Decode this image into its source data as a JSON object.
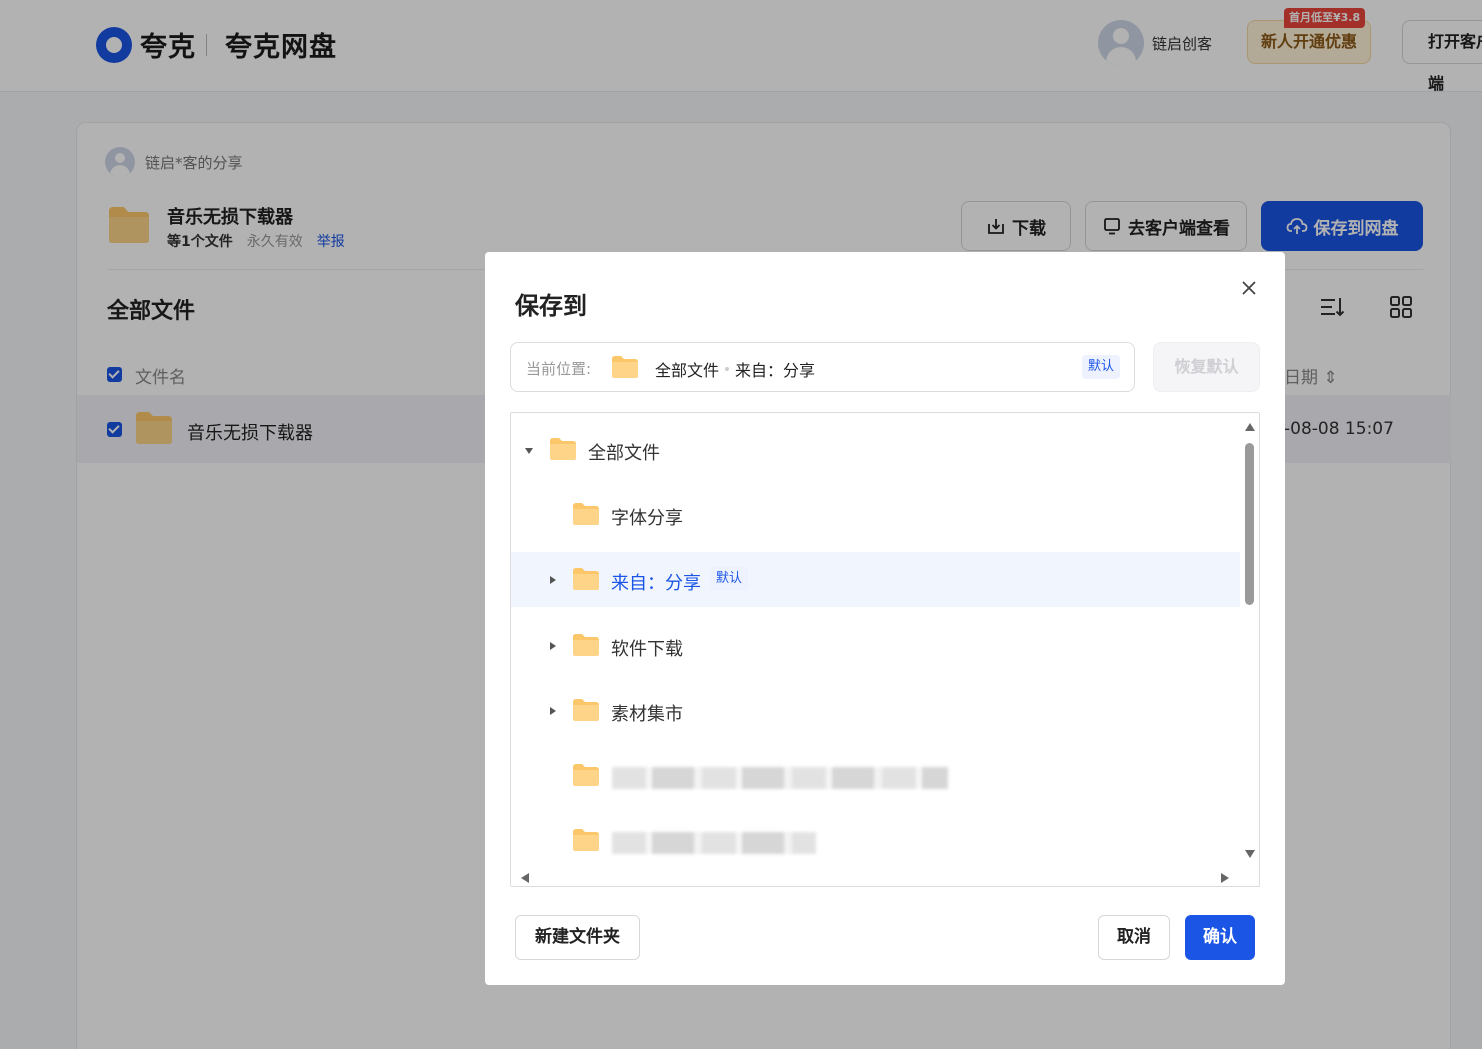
{
  "header": {
    "logo_text_1": "夸克",
    "logo_text_2": "夸克网盘",
    "user_name": "链启创客",
    "promo_badge": "首月低至¥3.8",
    "promo_label": "新人开通优惠",
    "open_client_label": "打开客户端"
  },
  "share": {
    "sharer": "链启*客的分享",
    "title": "音乐无损下载器",
    "count": "等1个文件",
    "validity": "永久有效",
    "report": "举报",
    "download_label": "下载",
    "client_label": "去客户端查看",
    "save_label": "保存到网盘"
  },
  "files": {
    "heading": "全部文件",
    "col_name": "文件名",
    "col_date": "日期",
    "rows": [
      {
        "name": "音乐无损下载器",
        "date": "-08-08 15:07"
      }
    ]
  },
  "modal": {
    "title": "保存到",
    "location_label": "当前位置:",
    "path": [
      "全部文件",
      "来自：分享"
    ],
    "default_tag": "默认",
    "restore_label": "恢复默认",
    "tree": [
      {
        "label": "全部文件",
        "level": 0,
        "expanded": true
      },
      {
        "label": "字体分享",
        "level": 1
      },
      {
        "label": "来自：分享",
        "level": 1,
        "selected": true,
        "default_tag": "默认"
      },
      {
        "label": "软件下载",
        "level": 1
      },
      {
        "label": "素材集市",
        "level": 1
      }
    ],
    "new_folder_label": "新建文件夹",
    "cancel_label": "取消",
    "confirm_label": "确认"
  },
  "colors": {
    "primary": "#1a55e6",
    "folder": "#fcc76a",
    "promo_bg": "#fff2d9",
    "badge_red": "#e9453a"
  },
  "icons": {
    "close": "close-icon",
    "folder": "folder-icon",
    "download": "download-icon",
    "monitor": "monitor-icon",
    "cloud_upload": "cloud-upload-icon",
    "sort": "sort-icon",
    "grid": "grid-icon"
  }
}
